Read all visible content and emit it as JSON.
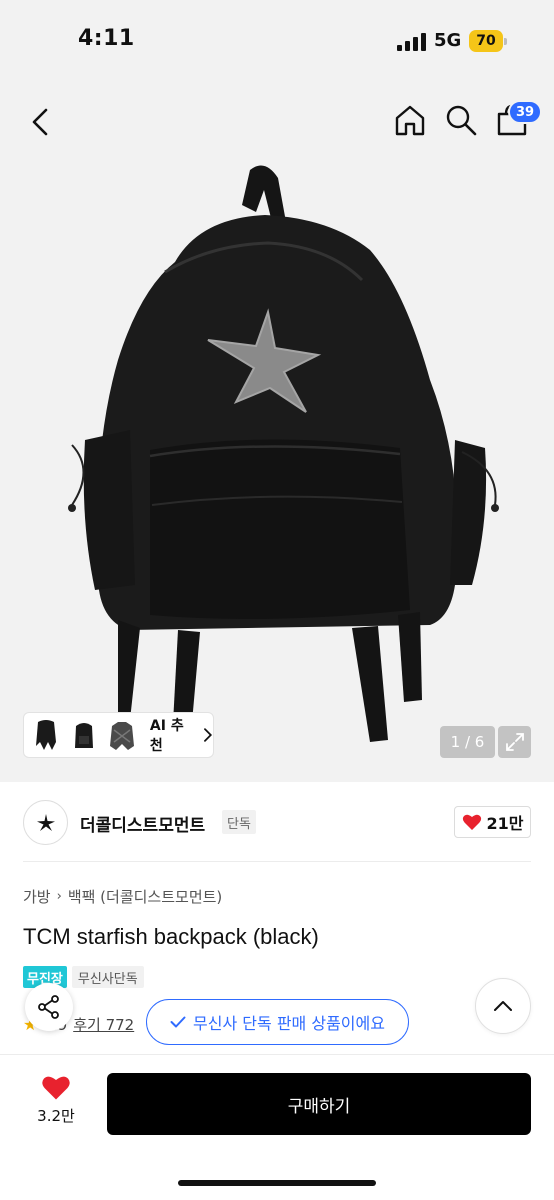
{
  "status_bar": {
    "time": "4:11",
    "network": "5G",
    "battery": "70",
    "battery_color": "#f5c518"
  },
  "nav": {
    "icons": [
      "back-icon",
      "home-icon",
      "search-icon",
      "cart-icon"
    ],
    "cart_badge": "39",
    "badge_color": "#2f6bff"
  },
  "gallery": {
    "ai_label": "AI 추천",
    "page_counter": "1 / 6"
  },
  "brand": {
    "name": "더콜디스트모먼트",
    "tag": "단독",
    "likes": "21만"
  },
  "breadcrumb": [
    "가방",
    "백팩 (더콜디스트모먼트)"
  ],
  "product": {
    "title": "TCM starfish backpack (black)",
    "badges": {
      "free_shipping": "무진장",
      "exclusive": "무신사단독"
    },
    "rating": "4.9",
    "reviews": "후기 772"
  },
  "toast": {
    "text": "무신사 단독 판매 상품이에요"
  },
  "bottom": {
    "wish_count": "3.2만",
    "buy_label": "구매하기"
  }
}
